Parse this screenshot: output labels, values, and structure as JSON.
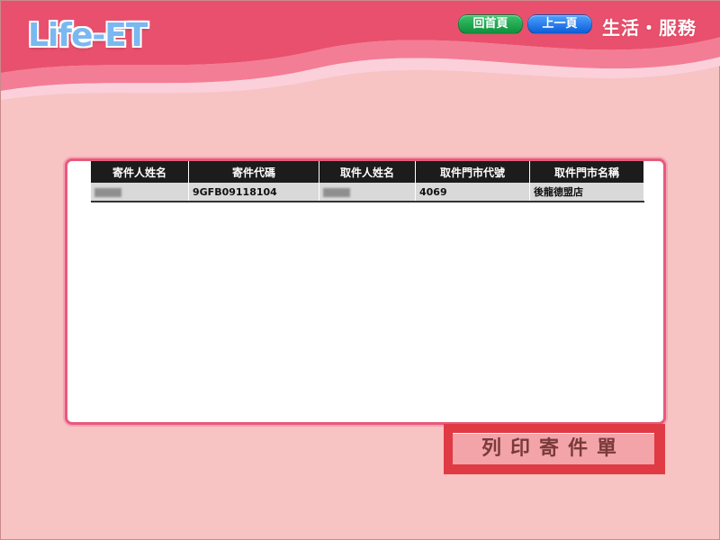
{
  "header": {
    "logo_text": "Life-ET",
    "home_button": "回首頁",
    "back_button": "上一頁",
    "brand": "生活・服務",
    "colors": {
      "home": "#1aa24a",
      "back": "#1a6ee6",
      "panel_border": "#e85a7a",
      "print_frame": "#e03a45"
    }
  },
  "table": {
    "columns": [
      "寄件人姓名",
      "寄件代碼",
      "取件人姓名",
      "取件門市代號",
      "取件門市名稱"
    ],
    "rows": [
      {
        "sender_name": "",
        "code": "9GFB09118104",
        "recipient_name": "",
        "store_id": "4069",
        "store_name": "後龍德盟店"
      }
    ]
  },
  "actions": {
    "print_label": "列印寄件單"
  }
}
